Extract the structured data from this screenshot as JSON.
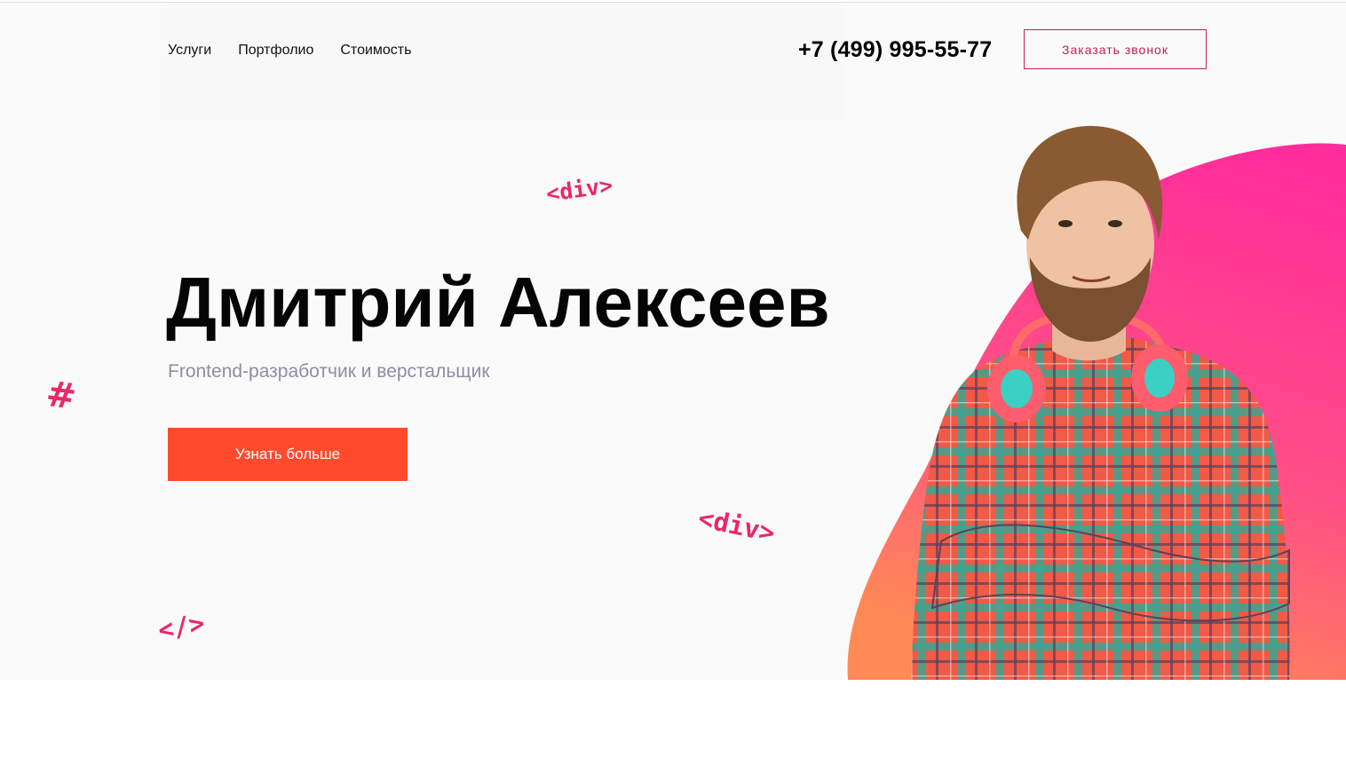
{
  "nav": {
    "items": [
      "Услуги",
      "Портфолио",
      "Стоимость"
    ]
  },
  "header": {
    "phone": "+7 (499) 995-55-77",
    "callback_label": "Заказать звонок"
  },
  "hero": {
    "title": "Дмитрий Алексеев",
    "subtitle": "Frontend-разработчик и верстальщик",
    "cta_label": "Узнать больше"
  },
  "decorations": {
    "div_tag": "<div>",
    "hash": "#",
    "close_tag": "</>"
  },
  "colors": {
    "accent_pink": "#e8286a",
    "button_orange": "#ff4a2e",
    "callback_border": "#c4204e",
    "blob_gradient_top": "#ff2d9b",
    "blob_gradient_bottom": "#ff8a55"
  },
  "icons": {
    "portrait": "person-portrait"
  }
}
